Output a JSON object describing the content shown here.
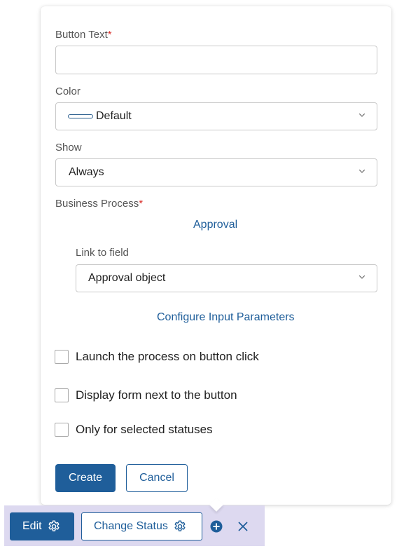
{
  "popover": {
    "button_text": {
      "label": "Button Text",
      "required_mark": "*",
      "value": ""
    },
    "color": {
      "label": "Color",
      "value": "Default",
      "swatch_color": "#2b5f8f"
    },
    "show": {
      "label": "Show",
      "value": "Always"
    },
    "business_process": {
      "label": "Business Process",
      "required_mark": "*",
      "process_link": "Approval",
      "link_to_field_label": "Link to field",
      "link_to_field_value": "Approval object",
      "configure_link": "Configure Input Parameters"
    },
    "checkboxes": [
      {
        "label": "Launch the process on button click",
        "checked": false
      },
      {
        "label": "Display form next to the button",
        "checked": false
      },
      {
        "label": "Only for selected statuses",
        "checked": false
      }
    ],
    "create_label": "Create",
    "cancel_label": "Cancel"
  },
  "toolbar": {
    "edit_label": "Edit",
    "change_status_label": "Change Status",
    "add_icon": "plus-circle-icon",
    "close_icon": "close-icon",
    "settings_icon": "gear-icon"
  },
  "colors": {
    "accent": "#1f5e9a",
    "required": "#d9302c",
    "toolbar_bg": "#ddd9f0"
  }
}
